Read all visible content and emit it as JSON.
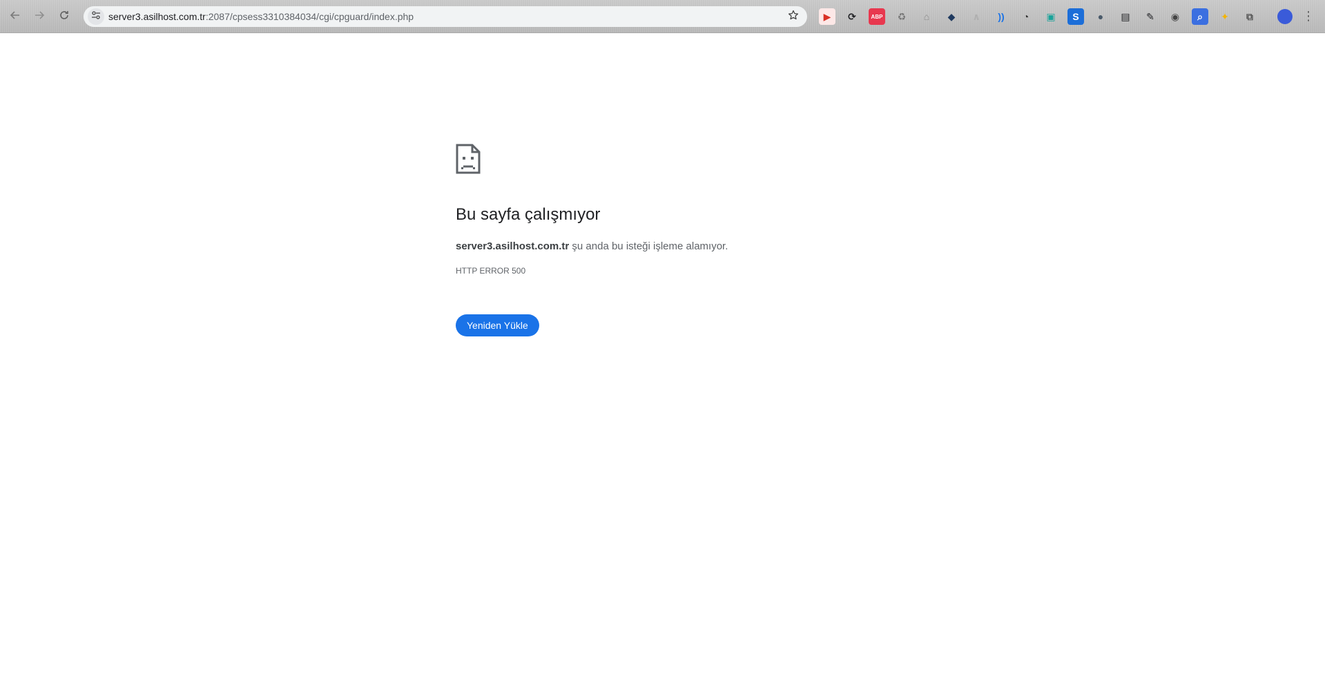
{
  "browser": {
    "url_host": "server3.asilhost.com.tr",
    "url_rest": ":2087/cpsess3310384034/cgi/cpguard/index.php",
    "icons": {
      "back": "arrow-left-icon",
      "forward": "arrow-right-icon",
      "reload": "reload-icon",
      "site_info": "tune-icon",
      "bookmark": "star-icon",
      "menu": "three-dots-icon"
    },
    "extensions": [
      {
        "name": "ext-red-play-icon",
        "glyph": "▶",
        "color": "#d93025",
        "bg": "#fde8e7"
      },
      {
        "name": "ext-sync-icon",
        "glyph": "⟳",
        "color": "#202124",
        "bg": "transparent"
      },
      {
        "name": "ext-adblock-icon",
        "glyph": "ABP",
        "color": "#ffffff",
        "bg": "#e8384f"
      },
      {
        "name": "ext-recycle-icon",
        "glyph": "♻",
        "color": "#777777",
        "bg": "transparent"
      },
      {
        "name": "ext-mouse-icon",
        "glyph": "⌂",
        "color": "#8a8a8a",
        "bg": "transparent"
      },
      {
        "name": "ext-shield-icon",
        "glyph": "◆",
        "color": "#1f3a5f",
        "bg": "transparent"
      },
      {
        "name": "ext-faded-icon",
        "glyph": "∧",
        "color": "#b0b0b0",
        "bg": "transparent"
      },
      {
        "name": "ext-sound-icon",
        "glyph": "))",
        "color": "#1a73e8",
        "bg": "transparent"
      },
      {
        "name": "ext-gauge-icon",
        "glyph": "◔",
        "color": "#333333",
        "bg": "transparent"
      },
      {
        "name": "ext-screen-icon",
        "glyph": "▣",
        "color": "#1aa39a",
        "bg": "transparent"
      },
      {
        "name": "ext-s-icon",
        "glyph": "S",
        "color": "#ffffff",
        "bg": "#1c6ed8"
      },
      {
        "name": "ext-owl-icon",
        "glyph": "●",
        "color": "#4a5a6a",
        "bg": "transparent"
      },
      {
        "name": "ext-clipboard-icon",
        "glyph": "▤",
        "color": "#202124",
        "bg": "transparent"
      },
      {
        "name": "ext-dropper-icon",
        "glyph": "✎",
        "color": "#202124",
        "bg": "transparent"
      },
      {
        "name": "ext-target-icon",
        "glyph": "◉",
        "color": "#444444",
        "bg": "transparent"
      },
      {
        "name": "ext-search-icon",
        "glyph": "⌕",
        "color": "#ffffff",
        "bg": "#3b6fe0"
      },
      {
        "name": "ext-google-icon",
        "glyph": "✦",
        "color": "#f4b400",
        "bg": "transparent"
      },
      {
        "name": "ext-puzzle-icon",
        "glyph": "⧉",
        "color": "#555555",
        "bg": "transparent"
      }
    ]
  },
  "error_page": {
    "icon": "sad-page-icon",
    "title": "Bu sayfa çalışmıyor",
    "message_host": "server3.asilhost.com.tr",
    "message_rest": " şu anda bu isteği işleme alamıyor.",
    "error_code": "HTTP ERROR 500",
    "reload_label": "Yeniden Yükle"
  },
  "colors": {
    "accent": "#1a73e8",
    "text_primary": "#202124",
    "text_secondary": "#5f6368"
  }
}
